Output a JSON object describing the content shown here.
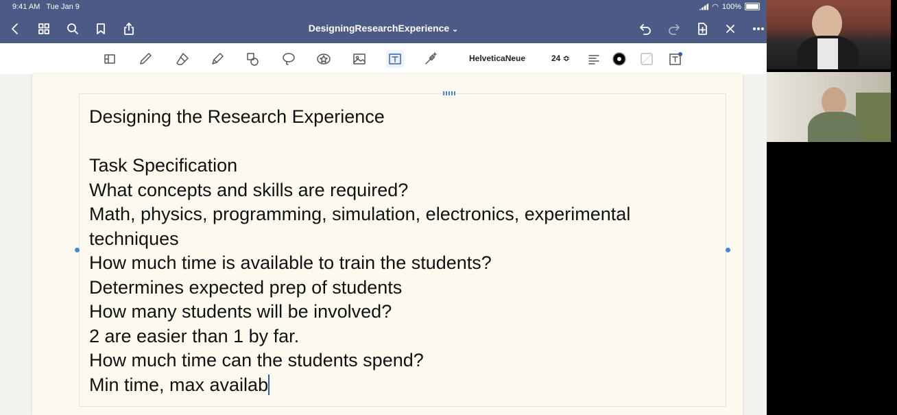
{
  "status_bar": {
    "time": "9:41 AM",
    "date": "Tue Jan 9",
    "battery": "100%"
  },
  "nav_bar": {
    "doc_title": "DesigningResearchExperience",
    "doc_title_chevron": "⌄",
    "icons": [
      "back-icon",
      "grid-icon",
      "search-icon",
      "bookmark-icon",
      "share-icon",
      "undo-icon",
      "redo-icon",
      "add-page-icon",
      "close-icon",
      "more-icon"
    ]
  },
  "toolbar": {
    "font_name": "HelveticaNeue",
    "font_size": "24",
    "font_size_arrows": "≎",
    "tools": [
      "layout-icon",
      "pen-icon",
      "eraser-icon",
      "highlighter-icon",
      "shapes-icon",
      "lasso-icon",
      "sticker-icon",
      "image-icon",
      "text-tool-icon",
      "laser-icon"
    ],
    "text_color": "#000000"
  },
  "document": {
    "lines": [
      "Designing the Research Experience",
      "",
      "Task Specification",
      "What concepts and skills are required?",
      "Math, physics, programming, simulation, electronics, experimental",
      "techniques",
      "How much time is available to train the students?",
      "Determines expected prep of students",
      "How many students will be involved?",
      "2 are easier than 1 by far.",
      "How much time can the students spend?",
      "Min time, max availab"
    ]
  },
  "video_tiles": [
    "participant-video-1",
    "participant-video-2"
  ]
}
